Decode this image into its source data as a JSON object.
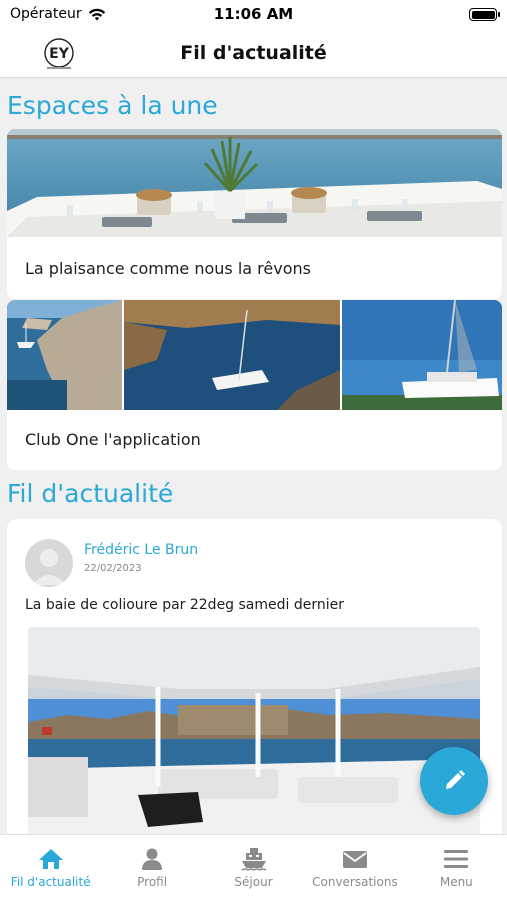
{
  "status_bar": {
    "carrier": "Opérateur",
    "time": "11:06 AM"
  },
  "header": {
    "title": "Fil d'actualité",
    "logo_text": "EY"
  },
  "featured": {
    "title": "Espaces à la une",
    "items": [
      {
        "caption": "La plaisance comme nous la rêvons"
      },
      {
        "caption": "Club One l'application"
      }
    ]
  },
  "feed": {
    "title": "Fil d'actualité",
    "posts": [
      {
        "author": "Frédéric Le Brun",
        "date": "22/02/2023",
        "text": "La baie de colioure par 22deg samedi dernier"
      }
    ]
  },
  "tabs": [
    {
      "label": "Fil d'actualité",
      "icon": "home-icon",
      "active": true
    },
    {
      "label": "Profil",
      "icon": "person-icon",
      "active": false
    },
    {
      "label": "Séjour",
      "icon": "boat-icon",
      "active": false
    },
    {
      "label": "Conversations",
      "icon": "envelope-icon",
      "active": false
    },
    {
      "label": "Menu",
      "icon": "hamburger-icon",
      "active": false
    }
  ],
  "colors": {
    "accent": "#2aa8d8",
    "background": "#f0f0f0",
    "tab_inactive": "#8a8a8a"
  }
}
